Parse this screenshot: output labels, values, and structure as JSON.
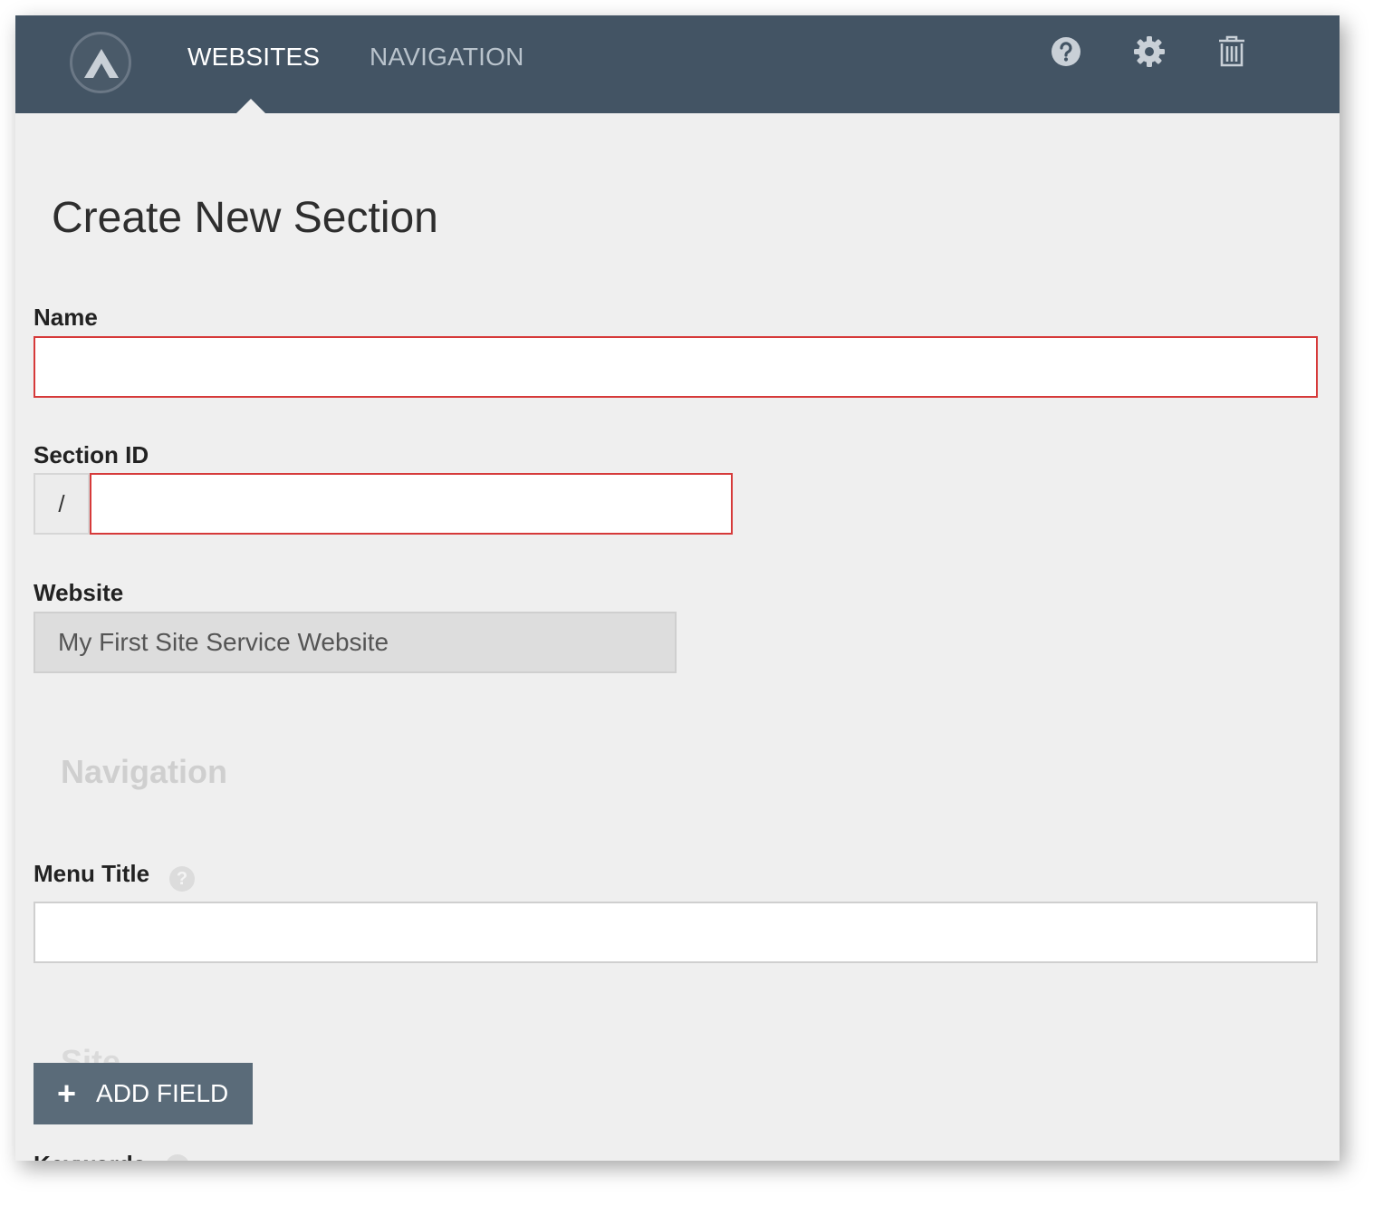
{
  "nav": {
    "tabs": [
      {
        "label": "WEBSITES",
        "active": true
      },
      {
        "label": "NAVIGATION",
        "active": false
      }
    ],
    "icons": [
      "help-icon",
      "gear-icon",
      "trash-icon"
    ]
  },
  "page": {
    "title": "Create New Section"
  },
  "form": {
    "name_label": "Name",
    "name_value": "",
    "section_id_label": "Section ID",
    "section_id_prefix": "/",
    "section_id_value": "",
    "website_label": "Website",
    "website_value": "My First Site Service Website",
    "navigation_heading": "Navigation",
    "menu_title_label": "Menu Title",
    "menu_title_help": "?",
    "menu_title_value": "",
    "site_heading": "Site",
    "keywords_label": "Keywords"
  },
  "actions": {
    "add_field_icon": "+",
    "add_field_label": "ADD FIELD"
  },
  "colors": {
    "topbar": "#435464",
    "error_border": "#d63a3a",
    "button": "#5a6b79",
    "background": "#efefef"
  }
}
